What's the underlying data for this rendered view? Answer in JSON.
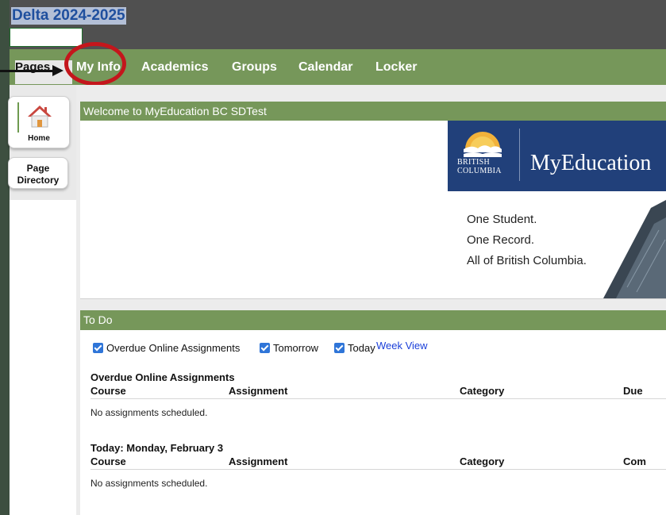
{
  "app": {
    "title": "Delta 2024-2025"
  },
  "nav": {
    "pages_label": "Pages",
    "tabs": [
      {
        "label": "My Info"
      },
      {
        "label": "Academics"
      },
      {
        "label": "Groups"
      },
      {
        "label": "Calendar"
      },
      {
        "label": "Locker"
      }
    ]
  },
  "sidebar": {
    "home_label": "Home",
    "page_directory_label_line1": "Page",
    "page_directory_label_line2": "Directory"
  },
  "welcome": {
    "header": "Welcome to MyEducation BC SDTest",
    "bc_line1": "BRITISH",
    "bc_line2": "COLUMBIA",
    "brand": "MyEducation",
    "tagline": [
      "One Student.",
      "One Record.",
      "All of British Columbia."
    ]
  },
  "todo": {
    "header": "To Do",
    "filters": [
      {
        "label": "Overdue Online Assignments",
        "checked": true
      },
      {
        "label": "Tomorrow",
        "checked": true
      },
      {
        "label": "Today",
        "checked": true
      }
    ],
    "week_view": "Week View",
    "sections": [
      {
        "title": "Overdue Online Assignments",
        "columns": [
          "Course",
          "Assignment",
          "Category",
          "Due"
        ],
        "empty": "No assignments scheduled."
      },
      {
        "title": "Today: Monday, February 3",
        "columns": [
          "Course",
          "Assignment",
          "Category",
          "Com"
        ],
        "empty": "No assignments scheduled."
      }
    ]
  },
  "colors": {
    "nav_green": "#76975a",
    "annotation_red": "#c4161c",
    "link_blue": "#1a3fd9",
    "banner_navy": "#21407a"
  }
}
